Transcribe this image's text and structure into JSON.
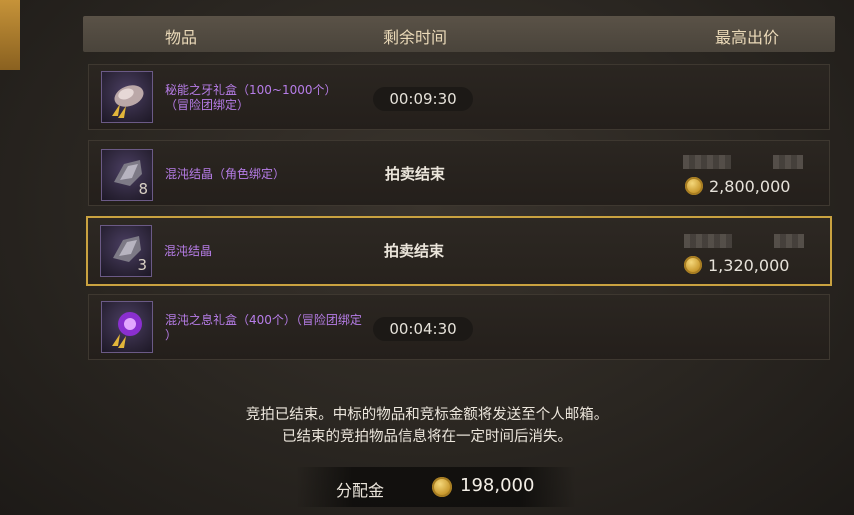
{
  "header": {
    "col_item": "物品",
    "col_time": "剩余时间",
    "col_bid": "最高出价"
  },
  "rows": [
    {
      "name_line1": "秘能之牙礼盒（100~1000个）",
      "name_line2": "（冒险团绑定）",
      "quantity": "",
      "time": "00:09:30",
      "status": "",
      "bid": ""
    },
    {
      "name_line1": "混沌结晶（角色绑定）",
      "name_line2": "",
      "quantity": "8",
      "time": "",
      "status": "拍卖结束",
      "bid": "2,800,000"
    },
    {
      "name_line1": "混沌结晶",
      "name_line2": "",
      "quantity": "3",
      "time": "",
      "status": "拍卖结束",
      "bid": "1,320,000"
    },
    {
      "name_line1": "混沌之息礼盒（400个）（冒险团绑定",
      "name_line2": "）",
      "quantity": "",
      "time": "00:04:30",
      "status": "",
      "bid": ""
    }
  ],
  "notice": {
    "line1": "竞拍已结束。中标的物品和竞标金额将发送至个人邮箱。",
    "line2": "已结束的竞拍物品信息将在一定时间后消失。"
  },
  "footer": {
    "label": "分配金",
    "amount": "198,000"
  },
  "icons": [
    "gem-box-icon",
    "crystal-icon",
    "crystal-icon",
    "orb-box-icon",
    "gold-coin-icon"
  ],
  "colors": {
    "item_name": "#b77de8",
    "selected_border": "#c9a240",
    "accent": "#c69339"
  }
}
